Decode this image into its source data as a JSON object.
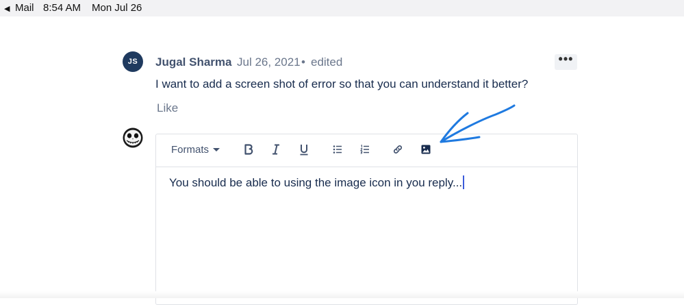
{
  "status_bar": {
    "back_label": "Mail",
    "time": "8:54 AM",
    "date": "Mon Jul 26"
  },
  "comment": {
    "avatar_initials": "JS",
    "author": "Jugal Sharma",
    "date": "Jul 26, 2021",
    "separator": "•",
    "edited": "edited",
    "more_label": "•••",
    "text": "I want to add a screen shot of error so that you can understand it better?",
    "like_label": "Like"
  },
  "editor": {
    "formats_label": "Formats",
    "toolbar_icons": [
      "bold-icon",
      "italic-icon",
      "underline-icon",
      "bullet-list-icon",
      "numbered-list-icon",
      "link-icon",
      "image-icon"
    ],
    "body_text": "You should be able to using the image icon in you reply..."
  },
  "colors": {
    "avatar_bg": "#1f3a5f",
    "annotation_arrow": "#1f7ae0",
    "text": "#172b4d",
    "muted": "#6b778c"
  }
}
